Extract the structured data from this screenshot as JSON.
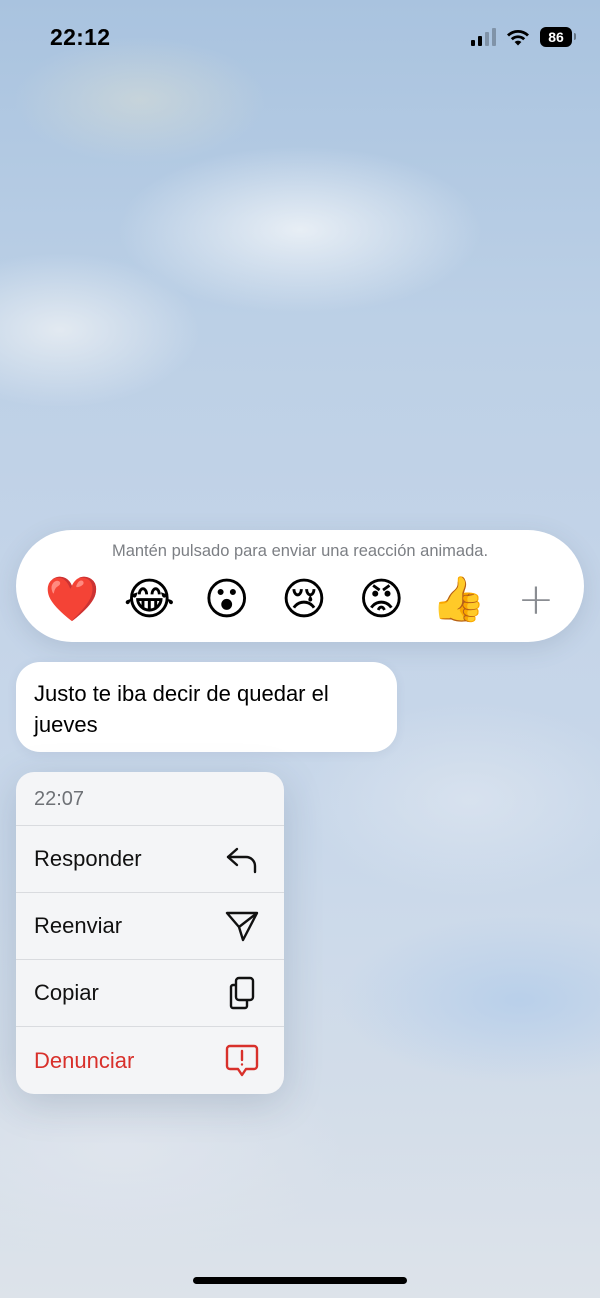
{
  "status_bar": {
    "time": "22:12",
    "battery_level": "86",
    "signal_bars_active": 2,
    "signal_bars_total": 4,
    "icons": [
      "cellular-signal-icon",
      "wifi-icon",
      "battery-icon"
    ]
  },
  "reactions": {
    "hint": "Mantén pulsado para enviar una reacción animada.",
    "emojis": [
      {
        "name": "heart",
        "glyph": "❤️"
      },
      {
        "name": "laughing",
        "glyph": "😂"
      },
      {
        "name": "surprised",
        "glyph": "😮"
      },
      {
        "name": "crying",
        "glyph": "😢"
      },
      {
        "name": "angry",
        "glyph": "😡"
      },
      {
        "name": "thumbs-up",
        "glyph": "👍"
      }
    ],
    "more_glyph": "+"
  },
  "message": {
    "text": "Justo te iba decir de quedar el jueves"
  },
  "menu": {
    "timestamp": "22:07",
    "items": [
      {
        "label": "Responder",
        "icon": "reply-icon"
      },
      {
        "label": "Reenviar",
        "icon": "forward-icon"
      },
      {
        "label": "Copiar",
        "icon": "copy-icon"
      },
      {
        "label": "Denunciar",
        "icon": "report-icon"
      }
    ],
    "danger_color": "#d8302b"
  }
}
